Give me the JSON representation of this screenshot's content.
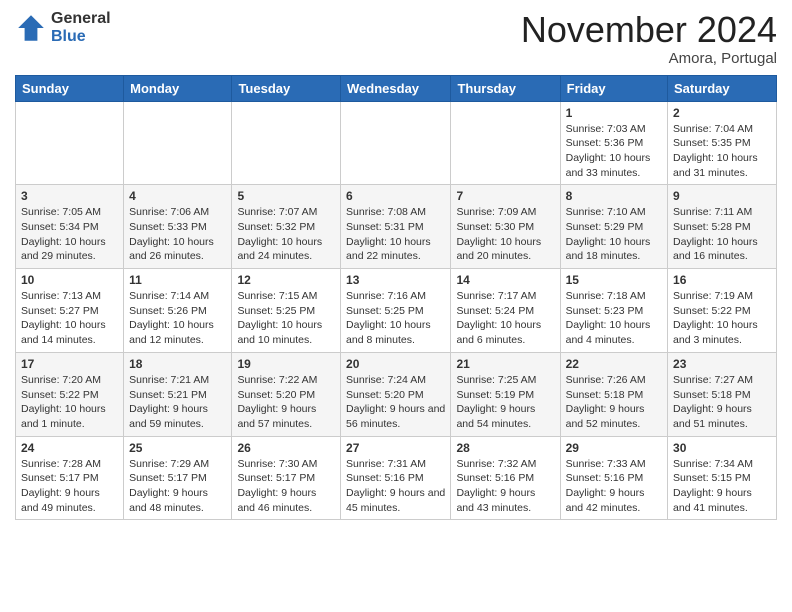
{
  "logo": {
    "general": "General",
    "blue": "Blue"
  },
  "header": {
    "month": "November 2024",
    "location": "Amora, Portugal"
  },
  "weekdays": [
    "Sunday",
    "Monday",
    "Tuesday",
    "Wednesday",
    "Thursday",
    "Friday",
    "Saturday"
  ],
  "weeks": [
    [
      {
        "day": "",
        "info": ""
      },
      {
        "day": "",
        "info": ""
      },
      {
        "day": "",
        "info": ""
      },
      {
        "day": "",
        "info": ""
      },
      {
        "day": "",
        "info": ""
      },
      {
        "day": "1",
        "info": "Sunrise: 7:03 AM\nSunset: 5:36 PM\nDaylight: 10 hours and 33 minutes."
      },
      {
        "day": "2",
        "info": "Sunrise: 7:04 AM\nSunset: 5:35 PM\nDaylight: 10 hours and 31 minutes."
      }
    ],
    [
      {
        "day": "3",
        "info": "Sunrise: 7:05 AM\nSunset: 5:34 PM\nDaylight: 10 hours and 29 minutes."
      },
      {
        "day": "4",
        "info": "Sunrise: 7:06 AM\nSunset: 5:33 PM\nDaylight: 10 hours and 26 minutes."
      },
      {
        "day": "5",
        "info": "Sunrise: 7:07 AM\nSunset: 5:32 PM\nDaylight: 10 hours and 24 minutes."
      },
      {
        "day": "6",
        "info": "Sunrise: 7:08 AM\nSunset: 5:31 PM\nDaylight: 10 hours and 22 minutes."
      },
      {
        "day": "7",
        "info": "Sunrise: 7:09 AM\nSunset: 5:30 PM\nDaylight: 10 hours and 20 minutes."
      },
      {
        "day": "8",
        "info": "Sunrise: 7:10 AM\nSunset: 5:29 PM\nDaylight: 10 hours and 18 minutes."
      },
      {
        "day": "9",
        "info": "Sunrise: 7:11 AM\nSunset: 5:28 PM\nDaylight: 10 hours and 16 minutes."
      }
    ],
    [
      {
        "day": "10",
        "info": "Sunrise: 7:13 AM\nSunset: 5:27 PM\nDaylight: 10 hours and 14 minutes."
      },
      {
        "day": "11",
        "info": "Sunrise: 7:14 AM\nSunset: 5:26 PM\nDaylight: 10 hours and 12 minutes."
      },
      {
        "day": "12",
        "info": "Sunrise: 7:15 AM\nSunset: 5:25 PM\nDaylight: 10 hours and 10 minutes."
      },
      {
        "day": "13",
        "info": "Sunrise: 7:16 AM\nSunset: 5:25 PM\nDaylight: 10 hours and 8 minutes."
      },
      {
        "day": "14",
        "info": "Sunrise: 7:17 AM\nSunset: 5:24 PM\nDaylight: 10 hours and 6 minutes."
      },
      {
        "day": "15",
        "info": "Sunrise: 7:18 AM\nSunset: 5:23 PM\nDaylight: 10 hours and 4 minutes."
      },
      {
        "day": "16",
        "info": "Sunrise: 7:19 AM\nSunset: 5:22 PM\nDaylight: 10 hours and 3 minutes."
      }
    ],
    [
      {
        "day": "17",
        "info": "Sunrise: 7:20 AM\nSunset: 5:22 PM\nDaylight: 10 hours and 1 minute."
      },
      {
        "day": "18",
        "info": "Sunrise: 7:21 AM\nSunset: 5:21 PM\nDaylight: 9 hours and 59 minutes."
      },
      {
        "day": "19",
        "info": "Sunrise: 7:22 AM\nSunset: 5:20 PM\nDaylight: 9 hours and 57 minutes."
      },
      {
        "day": "20",
        "info": "Sunrise: 7:24 AM\nSunset: 5:20 PM\nDaylight: 9 hours and 56 minutes."
      },
      {
        "day": "21",
        "info": "Sunrise: 7:25 AM\nSunset: 5:19 PM\nDaylight: 9 hours and 54 minutes."
      },
      {
        "day": "22",
        "info": "Sunrise: 7:26 AM\nSunset: 5:18 PM\nDaylight: 9 hours and 52 minutes."
      },
      {
        "day": "23",
        "info": "Sunrise: 7:27 AM\nSunset: 5:18 PM\nDaylight: 9 hours and 51 minutes."
      }
    ],
    [
      {
        "day": "24",
        "info": "Sunrise: 7:28 AM\nSunset: 5:17 PM\nDaylight: 9 hours and 49 minutes."
      },
      {
        "day": "25",
        "info": "Sunrise: 7:29 AM\nSunset: 5:17 PM\nDaylight: 9 hours and 48 minutes."
      },
      {
        "day": "26",
        "info": "Sunrise: 7:30 AM\nSunset: 5:17 PM\nDaylight: 9 hours and 46 minutes."
      },
      {
        "day": "27",
        "info": "Sunrise: 7:31 AM\nSunset: 5:16 PM\nDaylight: 9 hours and 45 minutes."
      },
      {
        "day": "28",
        "info": "Sunrise: 7:32 AM\nSunset: 5:16 PM\nDaylight: 9 hours and 43 minutes."
      },
      {
        "day": "29",
        "info": "Sunrise: 7:33 AM\nSunset: 5:16 PM\nDaylight: 9 hours and 42 minutes."
      },
      {
        "day": "30",
        "info": "Sunrise: 7:34 AM\nSunset: 5:15 PM\nDaylight: 9 hours and 41 minutes."
      }
    ]
  ]
}
